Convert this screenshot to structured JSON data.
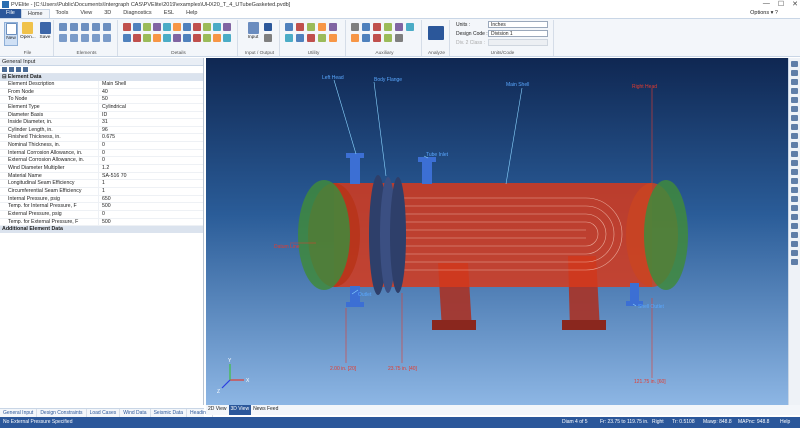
{
  "window": {
    "title": "PVElite - [C:\\Users\\Public\\Documents\\Intergraph CAS\\PVElite\\2019\\examples\\UHX20_T_4_UTubeGasketed.pvdb]",
    "controls": [
      "—",
      "☐",
      "✕"
    ]
  },
  "ribbon_tabs": [
    "File",
    "Home",
    "Tools",
    "View",
    "3D",
    "Diagnostics",
    "ESL",
    "Help"
  ],
  "active_tab": "Home",
  "options_label": "Options",
  "ribbon": {
    "file_buttons": {
      "new": "New",
      "open": "Open...",
      "save": "Save"
    },
    "group_labels": {
      "file": "File",
      "elements": "Elements",
      "details": "Details",
      "input_output": "Input / Output",
      "utility": "Utility",
      "auxiliary": "Auxiliary",
      "analyze": "Analyze",
      "units_code": "Units/Code"
    },
    "input_label": "Input",
    "units_label": "Units :",
    "units_value": "Inches",
    "design_code_label": "Design Code :",
    "design_code_value": "Division 1",
    "div2_class_label": "Div. 2 Class :"
  },
  "left_panel": {
    "title": "General Input",
    "section_title": "Element Data",
    "rows": [
      {
        "label": "Element Description",
        "value": "Main Shell"
      },
      {
        "label": "From Node",
        "value": "40"
      },
      {
        "label": "To Node",
        "value": "50"
      },
      {
        "label": "Element Type",
        "value": "Cylindrical"
      },
      {
        "label": "Diameter Basis",
        "value": "ID"
      },
      {
        "label": "Inside Diameter, in.",
        "value": "31"
      },
      {
        "label": "Cylinder Length, in.",
        "value": "96"
      },
      {
        "label": "Finished Thickness, in.",
        "value": "0.675"
      },
      {
        "label": "Nominal Thickness, in.",
        "value": "0"
      },
      {
        "label": "Internal Corrosion Allowance, in.",
        "value": "0"
      },
      {
        "label": "External Corrosion Allowance, in.",
        "value": "0"
      },
      {
        "label": "Wind Diameter Multiplier",
        "value": "1.2"
      },
      {
        "label": "Material Name",
        "value": "SA-516 70"
      },
      {
        "label": "Longitudinal Seam Efficiency",
        "value": "1"
      },
      {
        "label": "Circumferential Seam Efficiency",
        "value": "1"
      },
      {
        "label": "Internal Pressure, psig",
        "value": "650"
      },
      {
        "label": "Temp. for Internal Pressure, F",
        "value": "500"
      },
      {
        "label": "External Pressure, psig",
        "value": "0"
      },
      {
        "label": "Temp. for External Pressure, F",
        "value": "500"
      }
    ],
    "additional_section": "Additional Element Data"
  },
  "viewport": {
    "labels": {
      "left_head": "Left Head",
      "body_flange": "Body Flange",
      "main_shell": "Main Shell",
      "right_head": "Right Head",
      "tube_inlet": "Tube Inlet",
      "datum_line": "Datum Line",
      "outlet": "Outlet",
      "shell_outlet": "Shell Outlet"
    },
    "dimensions": {
      "d1": "2.00 in. [20]",
      "d2": "23.75 in. [40]",
      "d3": "121.75 in. [60]"
    },
    "axis": {
      "x": "X",
      "y": "Y",
      "z": "Z"
    },
    "colors": {
      "vessel": "#d63a1c",
      "heads": "#3f8a3c",
      "nozzles": "#3c6fd4",
      "flange": "#2e3f6a"
    }
  },
  "bottom_tabs_left": [
    "General Input",
    "Design Constraints",
    "Load Cases",
    "Wind Data",
    "Seismic Data",
    "Heading"
  ],
  "bottom_tabs_right": [
    "2D View",
    "3D View",
    "News Feed"
  ],
  "active_view_tab": "3D View",
  "status": {
    "left": "No External Pressure Specified",
    "diam": "Diam 4 of 5",
    "from_to": "Fr: 23.75 to 119.75 in.",
    "right": "Right",
    "thk": "Tr: 0.5108",
    "mawp": "Mawp: 848.8",
    "mapnc": "MAPnc: 948.8",
    "help": "Help"
  }
}
